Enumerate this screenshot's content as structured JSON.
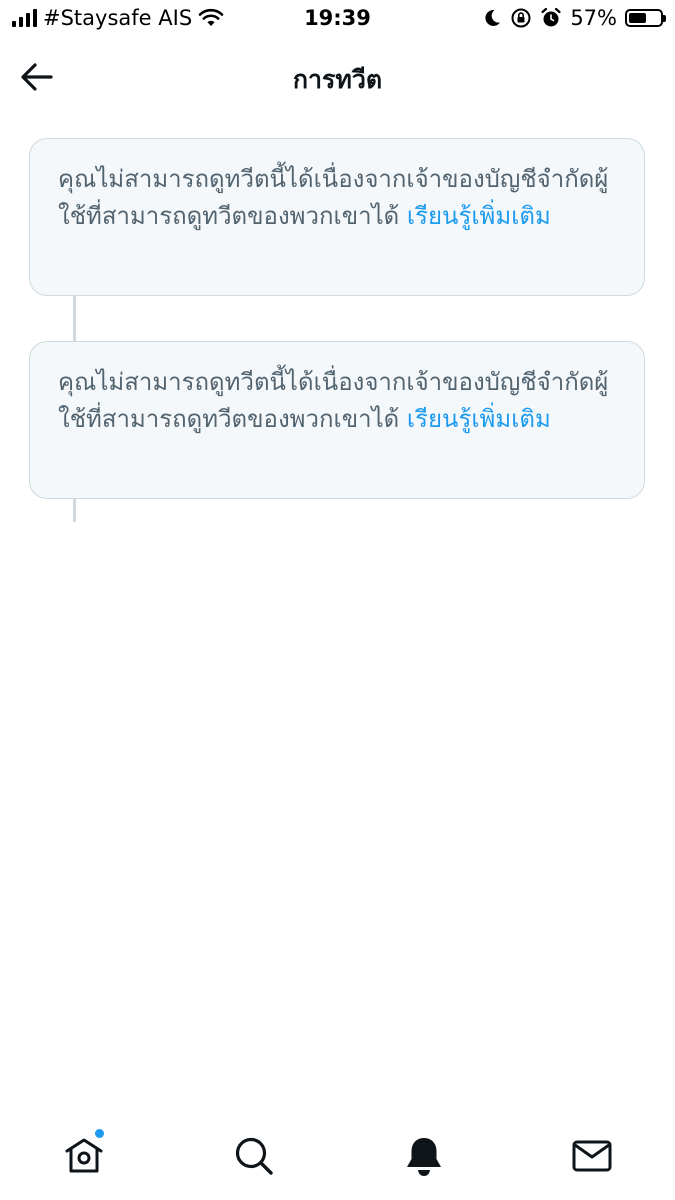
{
  "status_bar": {
    "carrier": "#Staysafe AIS",
    "time": "19:39",
    "battery_percent": "57%",
    "battery_level": 0.57,
    "icons": [
      "signal-icon",
      "wifi-icon",
      "moon-icon",
      "rotation-lock-icon",
      "alarm-icon",
      "battery-icon"
    ]
  },
  "header": {
    "title": "การทวีต",
    "back_icon": "back-arrow-icon"
  },
  "tweets": [
    {
      "message": "คุณไม่สามารถดูทวีตนี้ได้เนื่องจากเจ้าของบัญชีจำกัดผู้ใช้ที่สามารถดูทวีตของพวกเขาได้ ",
      "link": "เรียนรู้เพิ่มเติม"
    },
    {
      "message": "คุณไม่สามารถดูทวีตนี้ได้เนื่องจากเจ้าของบัญชีจำกัดผู้ใช้ที่สามารถดูทวีตของพวกเขาได้ ",
      "link": "เรียนรู้เพิ่มเติม"
    }
  ],
  "bottom_nav": {
    "items": [
      "home-icon",
      "search-icon",
      "notifications-icon",
      "messages-icon"
    ],
    "home_has_new_indicator": true
  },
  "colors": {
    "accent": "#1d9bf0",
    "card_background": "#f5f8fa",
    "card_border": "#cfd9de",
    "muted_text": "#536471",
    "primary_text": "#0f1419"
  }
}
